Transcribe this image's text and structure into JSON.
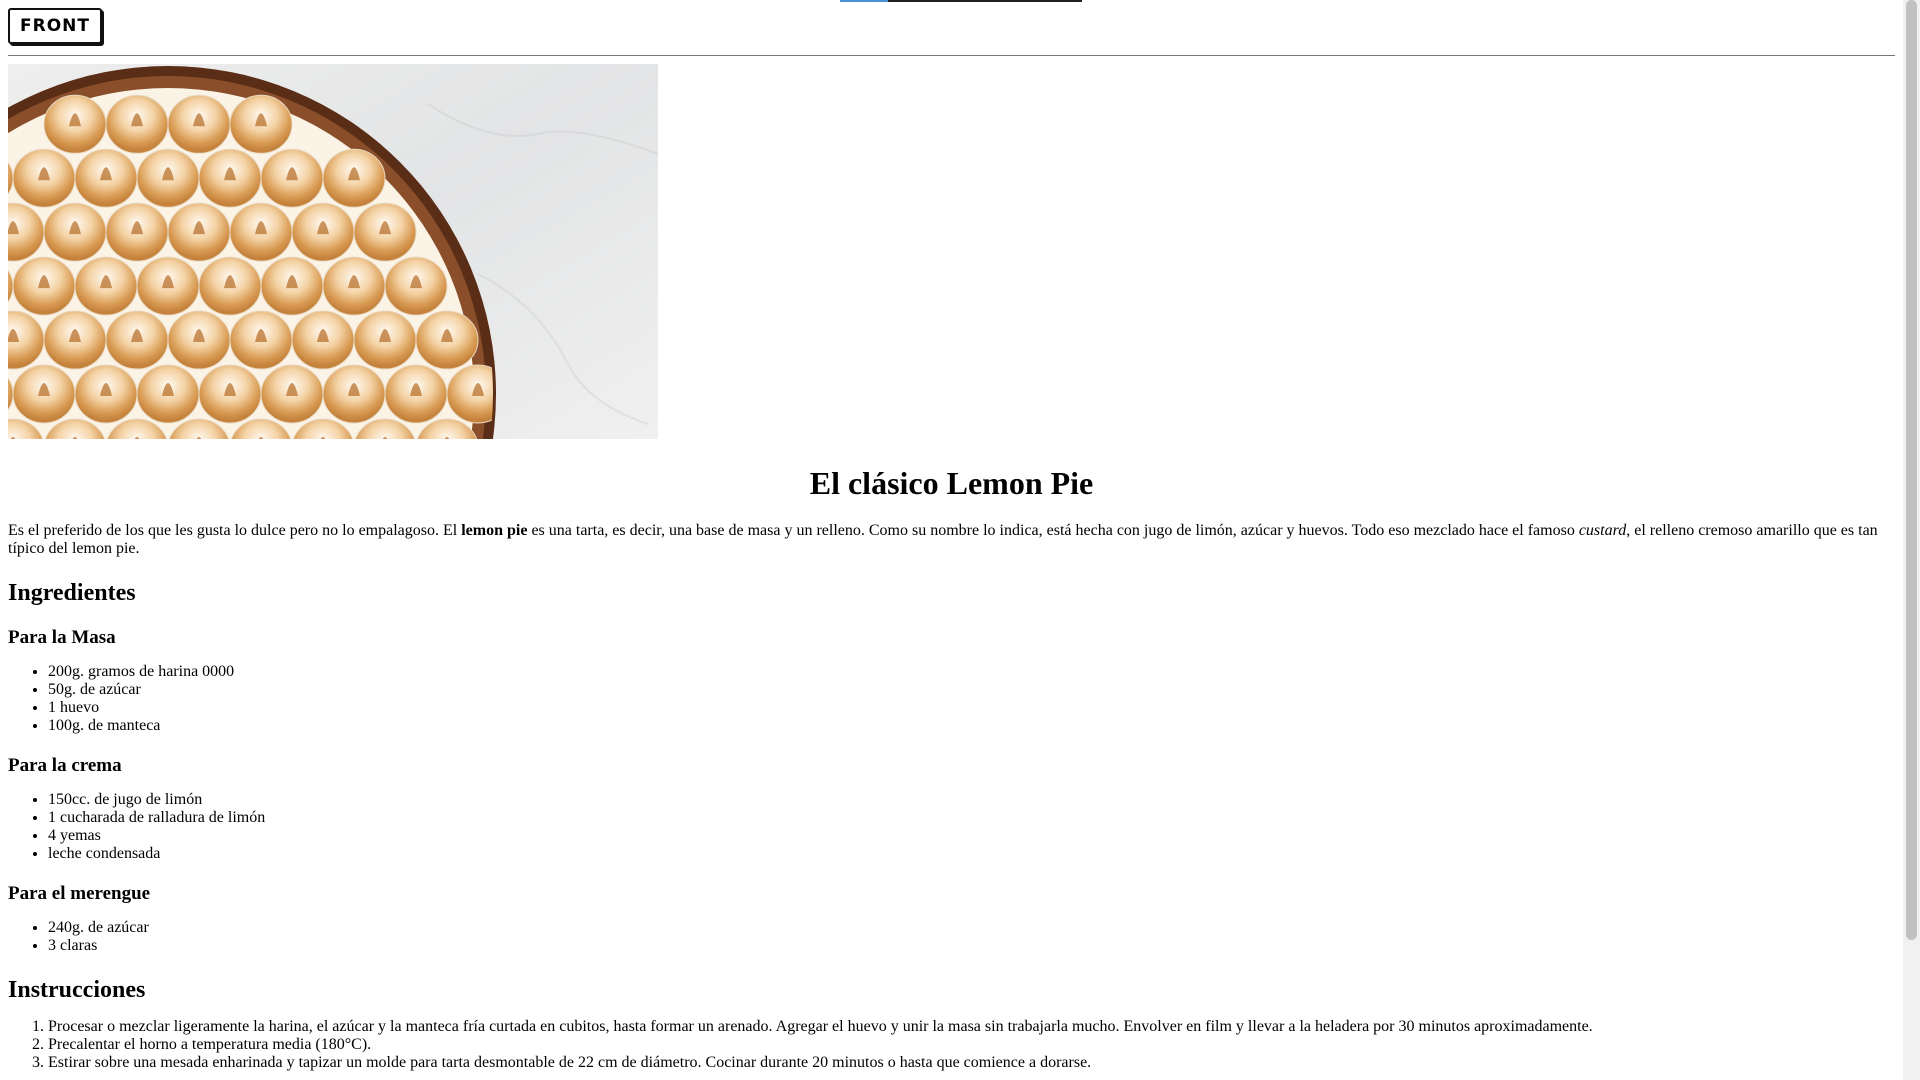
{
  "header": {
    "logo_text": "FRONT",
    "reading_progress": 0.2
  },
  "hero": {
    "image": "lemon-pie-meringue-photo"
  },
  "article": {
    "title": "El clásico Lemon Pie",
    "intro": {
      "part1": "Es el preferido de los que les gusta lo dulce pero no lo empalagoso. El ",
      "bold": "lemon pie",
      "part2": " es una tarta, es decir, una base de masa y un relleno. Como su nombre lo indica, está hecha con jugo de limón, azúcar y huevos. Todo eso mezclado hace el famoso ",
      "italic": "custard",
      "part3": ", el relleno cremoso amarillo que es tan típico del lemon pie."
    },
    "ingredients_heading": "Ingredientes",
    "sections": [
      {
        "title": "Para la Masa",
        "items": [
          "200g. gramos de harina 0000",
          "50g. de azúcar",
          "1 huevo",
          "100g. de manteca"
        ]
      },
      {
        "title": "Para la crema",
        "items": [
          "150cc. de jugo de limón",
          "1 cucharada de ralladura de limón",
          "4 yemas",
          "leche condensada"
        ]
      },
      {
        "title": "Para el merengue",
        "items": [
          "240g. de azúcar",
          "3 claras"
        ]
      }
    ],
    "instructions_heading": "Instrucciones",
    "instructions": [
      "Procesar o mezclar ligeramente la harina, el azúcar y la manteca fría curtada en cubitos, hasta formar un arenado. Agregar el huevo y unir la masa sin trabajarla mucho. Envolver en film y llevar a la heladera por 30 minutos aproximadamente.",
      "Precalentar el horno a temperatura media (180°C).",
      "Estirar sobre una mesada enharinada y tapizar un molde para tarta desmontable de 22 cm de diámetro. Cocinar durante 20 minutos o hasta que comience a dorarse."
    ]
  }
}
